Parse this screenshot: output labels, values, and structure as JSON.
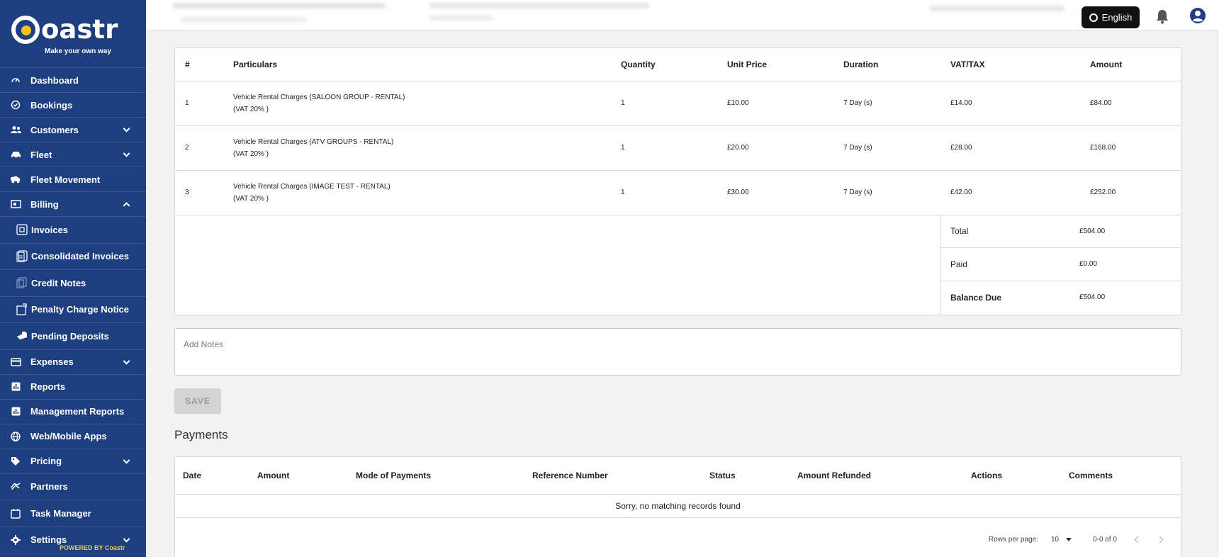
{
  "brand": {
    "name": "oastr",
    "tagline": "Make your own way",
    "powered": "POWERED BY Coastr",
    "accent": "#f4c21a",
    "sidebar_bg": "#1e3f7f"
  },
  "sidebar": {
    "items": [
      {
        "label": "Dashboard",
        "icon": "gauge-icon"
      },
      {
        "label": "Bookings",
        "icon": "check-circle-icon"
      },
      {
        "label": "Customers",
        "icon": "people-icon",
        "expand": "down"
      },
      {
        "label": "Fleet",
        "icon": "car-icon",
        "expand": "down"
      },
      {
        "label": "Fleet Movement",
        "icon": "truck-icon"
      },
      {
        "label": "Billing",
        "icon": "billing-icon",
        "expand": "up"
      },
      {
        "label": "Invoices",
        "icon": "invoice-icon",
        "sub": true
      },
      {
        "label": "Consolidated Invoices",
        "icon": "invoice-stack-icon",
        "sub": true
      },
      {
        "label": "Credit Notes",
        "icon": "credit-note-icon",
        "sub": true
      },
      {
        "label": "Penalty Charge Notice",
        "icon": "penalty-icon",
        "sub": true
      },
      {
        "label": "Pending Deposits",
        "icon": "deposit-icon",
        "sub": true
      },
      {
        "label": "Expenses",
        "icon": "card-icon",
        "expand": "down"
      },
      {
        "label": "Reports",
        "icon": "chart-icon"
      },
      {
        "label": "Management Reports",
        "icon": "chart-icon"
      },
      {
        "label": "Web/Mobile Apps",
        "icon": "globe-icon"
      },
      {
        "label": "Pricing",
        "icon": "tag-icon",
        "expand": "down"
      },
      {
        "label": "Partners",
        "icon": "handshake-icon"
      },
      {
        "label": "Task Manager",
        "icon": "calendar-icon"
      },
      {
        "label": "Settings",
        "icon": "gear-icon",
        "expand": "down"
      }
    ]
  },
  "topbar": {
    "language": "English"
  },
  "invoice": {
    "headers": [
      "#",
      "Particulars",
      "Quantity",
      "Unit Price",
      "Duration",
      "VAT/TAX",
      "Amount"
    ],
    "rows": [
      {
        "num": "1",
        "particular": "Vehicle Rental Charges (SALOON GROUP - RENTAL)",
        "vat_note": "(VAT 20% )",
        "qty": "1",
        "unit": "£10.00",
        "duration": "7 Day (s)",
        "vat": "£14.00",
        "amount": "£84.00"
      },
      {
        "num": "2",
        "particular": "Vehicle Rental Charges (ATV GROUPS - RENTAL)",
        "vat_note": "(VAT 20% )",
        "qty": "1",
        "unit": "£20.00",
        "duration": "7 Day (s)",
        "vat": "£28.00",
        "amount": "£168.00"
      },
      {
        "num": "3",
        "particular": "Vehicle Rental Charges (IMAGE TEST - RENTAL)",
        "vat_note": "(VAT 20% )",
        "qty": "1",
        "unit": "£30.00",
        "duration": "7 Day (s)",
        "vat": "£42.00",
        "amount": "£252.00"
      }
    ],
    "totals": {
      "total_label": "Total",
      "total": "£504.00",
      "paid_label": "Paid",
      "paid": "£0.00",
      "balance_label": "Balance Due",
      "balance": "£504.00"
    }
  },
  "notes": {
    "placeholder": "Add Notes"
  },
  "save_label": "SAVE",
  "payments": {
    "title": "Payments",
    "headers": [
      "Date",
      "Amount",
      "Mode of Payments",
      "Reference Number",
      "Status",
      "Amount Refunded",
      "Actions",
      "Comments"
    ],
    "empty": "Sorry, no matching records found",
    "rows_per_page_label": "Rows per page:",
    "rows_per_page": "10",
    "range": "0-0 of 0"
  }
}
